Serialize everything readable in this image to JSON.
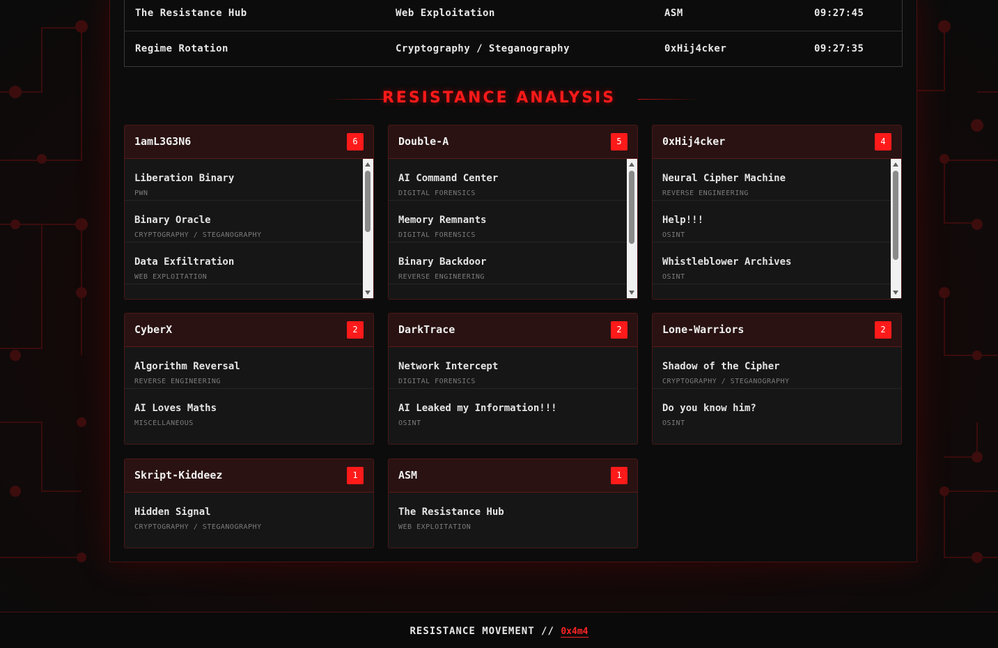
{
  "feed": {
    "rows": [
      {
        "challenge": "The Resistance Hub",
        "category": "Web Exploitation",
        "team": "ASM",
        "time": "09:27:45"
      },
      {
        "challenge": "Regime Rotation",
        "category": "Cryptography / Steganography",
        "team": "0xHij4cker",
        "time": "09:27:35"
      }
    ]
  },
  "analysis": {
    "title": "RESISTANCE ANALYSIS",
    "teams": [
      {
        "name": "1amL3G3N6",
        "count": "6",
        "solves": [
          {
            "name": "Liberation Binary",
            "category": "PWN"
          },
          {
            "name": "Binary Oracle",
            "category": "CRYPTOGRAPHY / STEGANOGRAPHY"
          },
          {
            "name": "Data Exfiltration",
            "category": "WEB EXPLOITATION"
          }
        ]
      },
      {
        "name": "Double-A",
        "count": "5",
        "solves": [
          {
            "name": "AI Command Center",
            "category": "DIGITAL FORENSICS"
          },
          {
            "name": "Memory Remnants",
            "category": "DIGITAL FORENSICS"
          },
          {
            "name": "Binary Backdoor",
            "category": "REVERSE ENGINEERING"
          }
        ]
      },
      {
        "name": "0xHij4cker",
        "count": "4",
        "solves": [
          {
            "name": "Neural Cipher Machine",
            "category": "REVERSE ENGINEERING"
          },
          {
            "name": "Help!!!",
            "category": "OSINT"
          },
          {
            "name": "Whistleblower Archives",
            "category": "OSINT"
          }
        ]
      },
      {
        "name": "CyberX",
        "count": "2",
        "solves": [
          {
            "name": "Algorithm Reversal",
            "category": "REVERSE ENGINEERING"
          },
          {
            "name": "AI Loves Maths",
            "category": "MISCELLANEOUS"
          }
        ]
      },
      {
        "name": "DarkTrace",
        "count": "2",
        "solves": [
          {
            "name": "Network Intercept",
            "category": "DIGITAL FORENSICS"
          },
          {
            "name": "AI Leaked my Information!!!",
            "category": "OSINT"
          }
        ]
      },
      {
        "name": "Lone-Warriors",
        "count": "2",
        "solves": [
          {
            "name": "Shadow of the Cipher",
            "category": "CRYPTOGRAPHY / STEGANOGRAPHY"
          },
          {
            "name": "Do you know him?",
            "category": "OSINT"
          }
        ]
      },
      {
        "name": "Skript-Kiddeez",
        "count": "1",
        "solves": [
          {
            "name": "Hidden Signal",
            "category": "CRYPTOGRAPHY / STEGANOGRAPHY"
          }
        ]
      },
      {
        "name": "ASM",
        "count": "1",
        "solves": [
          {
            "name": "The Resistance Hub",
            "category": "WEB EXPLOITATION"
          }
        ]
      }
    ]
  },
  "footer": {
    "text": "RESISTANCE MOVEMENT //",
    "author": "0x4m4"
  },
  "colors": {
    "accent": "#ff1a1a",
    "panel_border": "#4a1212",
    "card_header": "#2a1212",
    "background": "#0b0b0b"
  }
}
